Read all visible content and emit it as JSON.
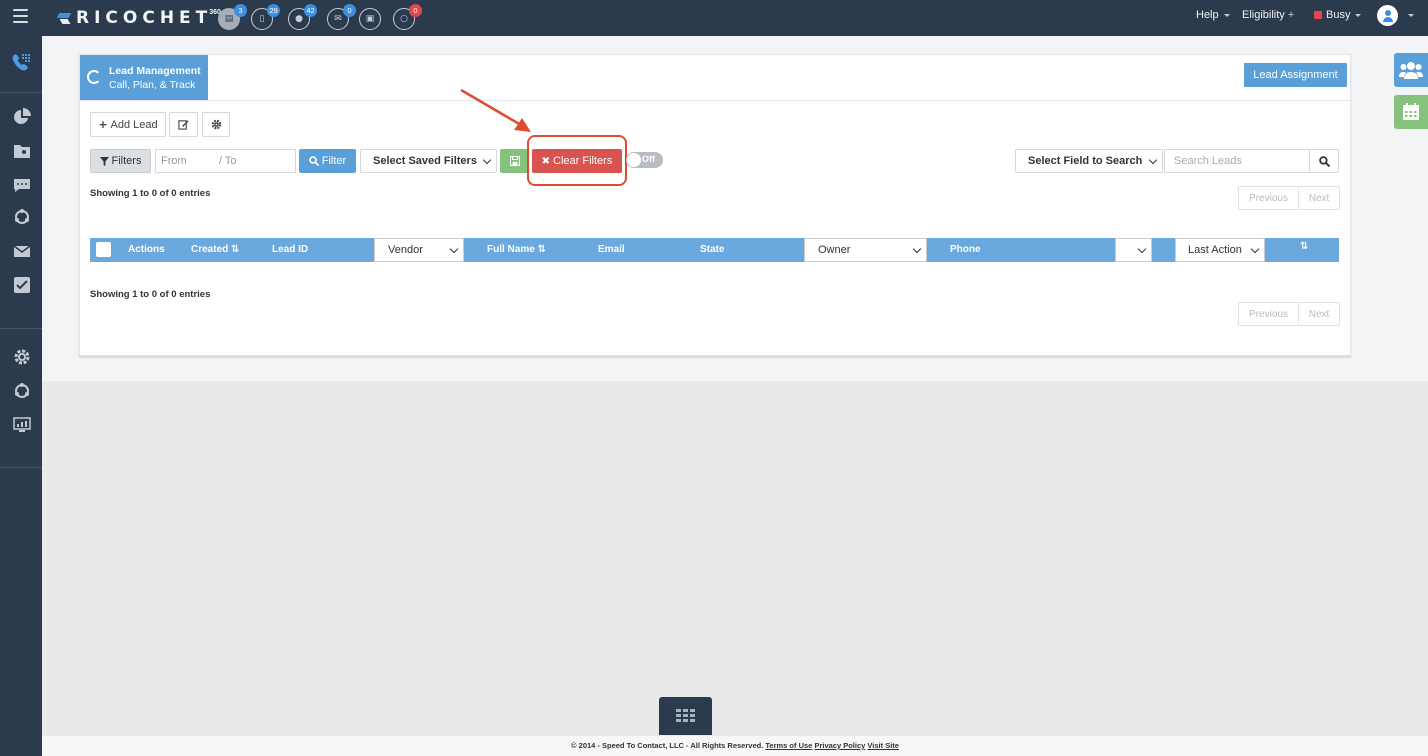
{
  "brand": {
    "name": "RICOCHET",
    "sup": "360"
  },
  "notifications": [
    {
      "name": "leads",
      "count": "3",
      "icon": "document-icon"
    },
    {
      "name": "documents",
      "count": "29",
      "icon": "file-icon"
    },
    {
      "name": "chats",
      "count": "42",
      "icon": "chat-icon"
    },
    {
      "name": "mail",
      "count": "0",
      "icon": "mail-icon"
    },
    {
      "name": "inbox",
      "count": "",
      "icon": "inbox-icon"
    },
    {
      "name": "messages",
      "count": "0",
      "icon": "speech-bubble-icon"
    }
  ],
  "topnav": {
    "help": "Help",
    "eligibility": "Eligibility",
    "eligibility_plus": "+",
    "status": "Busy"
  },
  "panel": {
    "title": "Lead Management",
    "subtitle": "Call, Plan, & Track",
    "lead_assignment": "Lead Assignment"
  },
  "toolbar": {
    "add_lead": "Add Lead",
    "filters": "Filters",
    "from_placeholder": "From",
    "to_placeholder": "/  To",
    "filter": "Filter",
    "saved_filters": "Select Saved Filters",
    "clear_filters": "Clear Filters",
    "toggle_label": "Off",
    "search_field": "Select Field to Search",
    "search_placeholder": "Search Leads"
  },
  "info_top": "Showing 1 to 0 of 0 entries",
  "info_bottom": "Showing 1 to 0 of 0 entries",
  "pager": {
    "previous": "Previous",
    "next": "Next"
  },
  "table": {
    "actions": "Actions",
    "created": "Created",
    "lead_id": "Lead ID",
    "vendor": "Vendor",
    "full_name": "Full Name",
    "email": "Email",
    "state": "State",
    "owner": "Owner",
    "phone": "Phone",
    "last_action": "Last Action",
    "sort_glyph": "⇅"
  },
  "footer": {
    "copyright": "© 2014 - Speed To Contact, LLC - All Rights Reserved.",
    "terms": "Terms of Use",
    "privacy": "Privacy Policy",
    "visit": "Visit Site"
  },
  "colors": {
    "topbar": "#2b3a4d",
    "accent": "#5a9fd8",
    "danger": "#d9534f",
    "success": "#86c17d",
    "annotation": "#df4b2e"
  }
}
